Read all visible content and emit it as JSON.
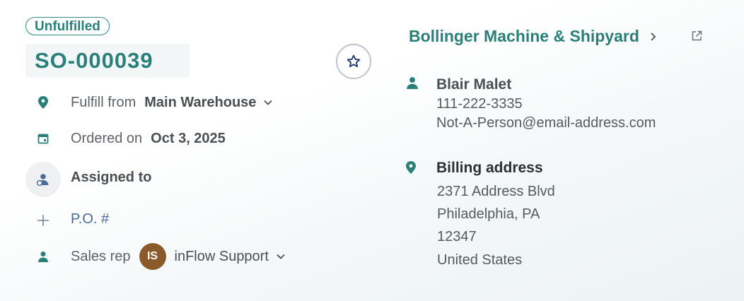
{
  "order": {
    "status": "Unfulfilled",
    "id": "SO-000039"
  },
  "details": {
    "fulfill_label": "Fulfill from",
    "fulfill_value": "Main Warehouse",
    "ordered_label": "Ordered on",
    "ordered_value": "Oct 3, 2025",
    "assigned_label": "Assigned to",
    "po_label": "P.O. #",
    "sales_rep_label": "Sales rep",
    "sales_rep_initials": "IS",
    "sales_rep_name": "inFlow Support"
  },
  "customer": {
    "name": "Bollinger Machine & Shipyard",
    "contact_name": "Blair Malet",
    "phone": "111-222-3335",
    "email": "Not-A-Person@email-address.com",
    "billing_title": "Billing address",
    "address_lines": [
      "2371 Address Blvd",
      "Philadelphia, PA",
      "12347",
      "United States"
    ]
  },
  "colors": {
    "accent": "#2a7f79",
    "link": "#4a6b9a",
    "avatar": "#8b5a2b"
  },
  "icons": [
    "star-icon",
    "location-pin-icon",
    "calendar-icon",
    "assign-user-icon",
    "plus-icon",
    "person-icon",
    "chevron-down-icon",
    "chevron-right-icon",
    "external-link-icon"
  ]
}
